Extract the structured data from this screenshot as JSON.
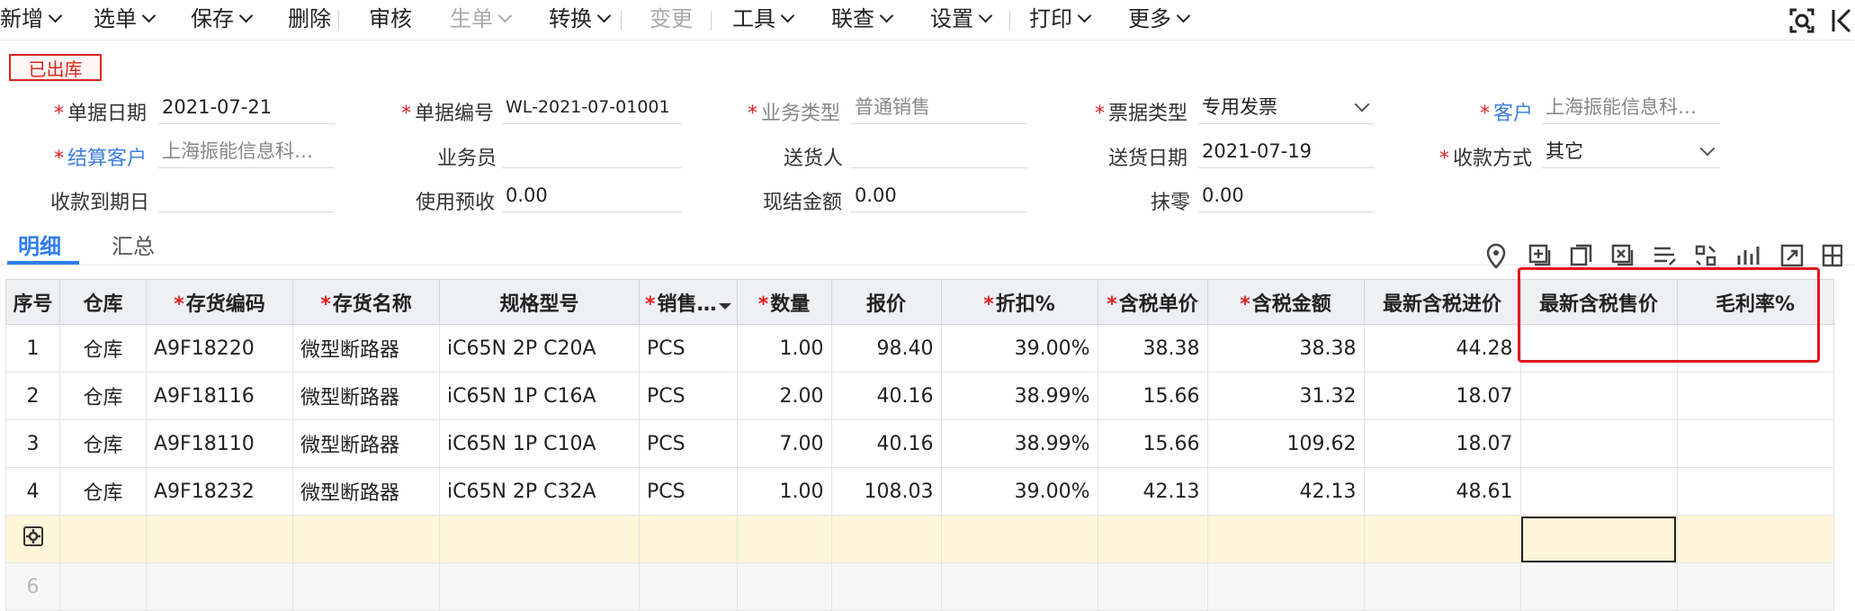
{
  "toolbar": {
    "items": [
      {
        "label": "新增",
        "dropdown": true,
        "disabled": false
      },
      {
        "label": "选单",
        "dropdown": true,
        "disabled": false
      },
      {
        "label": "保存",
        "dropdown": true,
        "disabled": false
      },
      {
        "label": "删除",
        "dropdown": false,
        "disabled": false
      },
      {
        "label": "审核",
        "dropdown": false,
        "disabled": false
      },
      {
        "label": "生单",
        "dropdown": true,
        "disabled": true
      },
      {
        "label": "转换",
        "dropdown": true,
        "disabled": false
      },
      {
        "label": "变更",
        "dropdown": false,
        "disabled": true
      },
      {
        "label": "工具",
        "dropdown": true,
        "disabled": false
      },
      {
        "label": "联查",
        "dropdown": true,
        "disabled": false
      },
      {
        "label": "设置",
        "dropdown": true,
        "disabled": false
      },
      {
        "label": "打印",
        "dropdown": true,
        "disabled": false
      },
      {
        "label": "更多",
        "dropdown": true,
        "disabled": false
      }
    ],
    "right_icons": [
      "scan-icon",
      "prev-record-icon"
    ]
  },
  "status": "已出库",
  "form": {
    "doc_date": {
      "label": "单据日期",
      "value": "2021-07-21"
    },
    "doc_no": {
      "label": "单据编号",
      "value": "WL-2021-07-01001"
    },
    "biz_type": {
      "label": "业务类型",
      "value": "普通销售"
    },
    "invoice_type": {
      "label": "票据类型",
      "value": "专用发票"
    },
    "customer": {
      "label": "客户",
      "value": "上海振能信息科…"
    },
    "settle_customer": {
      "label": "结算客户",
      "value": "上海振能信息科…"
    },
    "salesman": {
      "label": "业务员",
      "value": ""
    },
    "deliverer": {
      "label": "送货人",
      "value": ""
    },
    "delivery_date": {
      "label": "送货日期",
      "value": "2021-07-19"
    },
    "payment_method": {
      "label": "收款方式",
      "value": "其它"
    },
    "due_date": {
      "label": "收款到期日",
      "value": ""
    },
    "use_prepaid": {
      "label": "使用预收",
      "value": "0.00"
    },
    "cash_amount": {
      "label": "现结金额",
      "value": "0.00"
    },
    "rounding": {
      "label": "抹零",
      "value": "0.00"
    }
  },
  "tabs": [
    "明细",
    "汇总"
  ],
  "grid_icons": [
    "location-icon",
    "add-row-icon",
    "copy-row-icon",
    "delete-row-icon",
    "batch-edit-icon",
    "split-icon",
    "chart-icon",
    "export-icon",
    "columns-icon"
  ],
  "table": {
    "columns": [
      {
        "label": "序号",
        "required": false
      },
      {
        "label": "仓库",
        "required": false
      },
      {
        "label": "存货编码",
        "required": true
      },
      {
        "label": "存货名称",
        "required": true
      },
      {
        "label": "规格型号",
        "required": false
      },
      {
        "label": "销售…",
        "required": true
      },
      {
        "label": "数量",
        "required": true
      },
      {
        "label": "报价",
        "required": false
      },
      {
        "label": "折扣%",
        "required": true
      },
      {
        "label": "含税单价",
        "required": true
      },
      {
        "label": "含税金额",
        "required": true
      },
      {
        "label": "最新含税进价",
        "required": false
      },
      {
        "label": "最新含税售价",
        "required": false
      },
      {
        "label": "毛利率%",
        "required": false
      }
    ],
    "rows": [
      [
        "1",
        "仓库",
        "A9F18220",
        "微型断路器",
        "iC65N 2P C20A",
        "PCS",
        "1.00",
        "98.40",
        "39.00%",
        "38.38",
        "38.38",
        "44.28",
        "",
        ""
      ],
      [
        "2",
        "仓库",
        "A9F18116",
        "微型断路器",
        "iC65N 1P C16A",
        "PCS",
        "2.00",
        "40.16",
        "38.99%",
        "15.66",
        "31.32",
        "18.07",
        "",
        ""
      ],
      [
        "3",
        "仓库",
        "A9F18110",
        "微型断路器",
        "iC65N 1P C10A",
        "PCS",
        "7.00",
        "40.16",
        "38.99%",
        "15.66",
        "109.62",
        "18.07",
        "",
        ""
      ],
      [
        "4",
        "仓库",
        "A9F18232",
        "微型断路器",
        "iC65N 2P C32A",
        "PCS",
        "1.00",
        "108.03",
        "39.00%",
        "42.13",
        "42.13",
        "48.61",
        "",
        ""
      ]
    ],
    "blank_row_no": "6"
  },
  "colors": {
    "accent": "#2f7ef0",
    "required": "#e02020",
    "highlight": "#e0141e",
    "status": "#d9261c"
  }
}
